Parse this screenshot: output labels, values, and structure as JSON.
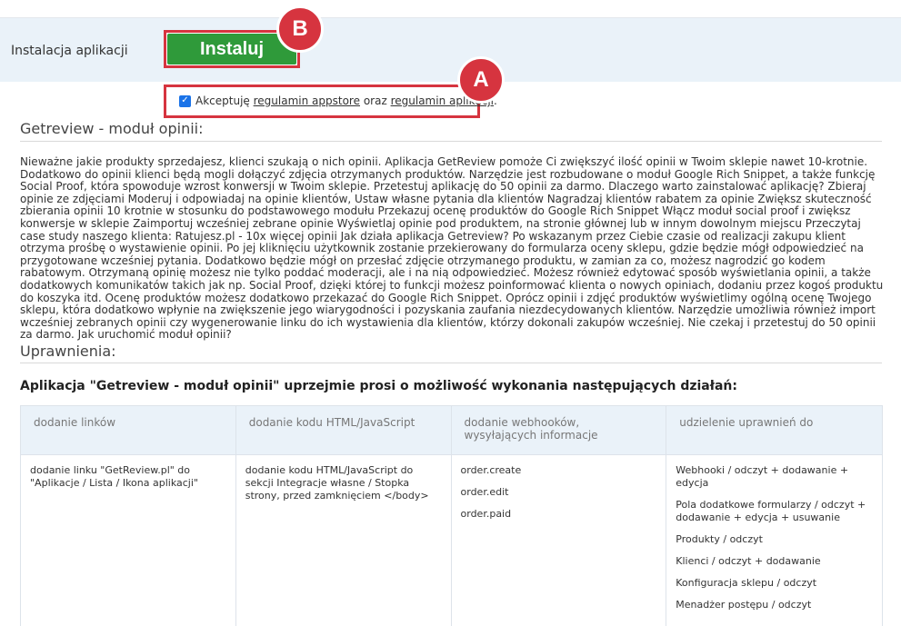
{
  "install": {
    "label": "Instalacja aplikacji",
    "button_label": "Instaluj",
    "badge_b": "B",
    "badge_a": "A",
    "accept_prefix": "Akceptuję",
    "accept_link1": "regulamin appstore",
    "accept_middle": "oraz",
    "accept_link2": "regulamin aplikacji",
    "accept_suffix": ".",
    "accept_checked": true
  },
  "module": {
    "title": "Getreview - moduł opinii:",
    "description": "Nieważne jakie produkty sprzedajesz, klienci szukają o nich opinii. Aplikacja GetReview pomoże Ci zwiększyć ilość opinii w Twoim sklepie nawet 10-krotnie. Dodatkowo do opinii klienci będą mogli dołączyć zdjęcia otrzymanych produktów. Narzędzie jest rozbudowane o moduł Google Rich Snippet, a także funkcję Social Proof, która spowoduje wzrost konwersji w Twoim sklepie. Przetestuj aplikację do 50 opinii za darmo. Dlaczego warto zainstalować aplikację? Zbieraj opinie ze zdjęciami Moderuj i odpowiadaj na opinie klientów, Ustaw własne pytania dla klientów Nagradzaj klientów rabatem za opinie Zwiększ skuteczność zbierania opinii 10 krotnie w stosunku do podstawowego modułu Przekazuj ocenę produktów do Google Rich Snippet Włącz moduł social proof i zwiększ konwersje w sklepie Zaimportuj wcześniej zebrane opinie Wyświetlaj opinie pod produktem, na stronie głównej lub w innym dowolnym miejscu Przeczytaj case study naszego klienta: Ratujesz.pl - 10x więcej opinii Jak działa aplikacja Getreview? Po wskazanym przez Ciebie czasie od realizacji zakupu klient otrzyma prośbę o wystawienie opinii. Po jej kliknięciu użytkownik zostanie przekierowany do formularza oceny sklepu, gdzie będzie mógł odpowiedzieć na przygotowane wcześniej pytania. Dodatkowo będzie mógł on przesłać zdjęcie otrzymanego produktu, w zamian za co, możesz nagrodzić go kodem rabatowym. Otrzymaną opinię możesz nie tylko poddać moderacji, ale i na nią odpowiedzieć. Możesz również edytować sposób wyświetlania opinii, a także dodatkowych komunikatów takich jak np. Social Proof, dzięki której to funkcji możesz poinformować klienta o nowych opiniach, dodaniu przez kogoś produktu do koszyka itd. Ocenę produktów możesz dodatkowo przekazać do Google Rich Snippet. Oprócz opinii i zdjęć produktów wyświetlimy ogólną ocenę Twojego sklepu, która dodatkowo wpłynie na zwiększenie jego wiarygodności i pozyskania zaufania niezdecydowanych klientów. Narzędzie umożliwia również import wcześniej zebranych opinii czy wygenerowanie linku do ich wystawienia dla klientów, którzy dokonali zakupów wcześniej. Nie czekaj i przetestuj do 50 opinii za darmo. Jak uruchomić moduł opinii?"
  },
  "permissions": {
    "title": "Uprawnienia:",
    "heading": "Aplikacja \"Getreview - moduł opinii\" uprzejmie prosi o możliwość wykonania następujących działań:",
    "columns": [
      "dodanie linków",
      "dodanie kodu HTML/JavaScript",
      "dodanie webhooków, wysyłających informacje",
      "udzielenie uprawnień do"
    ],
    "links_cell": "dodanie linku \"GetReview.pl\" do \"Aplikacje / Lista / Ikona aplikacji\"",
    "html_cell": "dodanie kodu HTML/JavaScript do sekcji Integracje własne / Stopka strony, przed zamknięciem </body>",
    "webhooks": [
      "order.create",
      "order.edit",
      "order.paid"
    ],
    "grants": [
      "Webhooki / odczyt + dodawanie + edycja",
      "Pola dodatkowe formularzy / odczyt + dodawanie + edycja + usuwanie",
      "Produkty / odczyt",
      "Klienci / odczyt + dodawanie",
      "Konfiguracja sklepu / odczyt",
      "Menadżer postępu / odczyt"
    ]
  },
  "colors": {
    "install_button": "#2f9a3a",
    "highlight": "#d6343f",
    "install_bar_bg": "#eaf2f9",
    "checkbox": "#1a73e8"
  }
}
